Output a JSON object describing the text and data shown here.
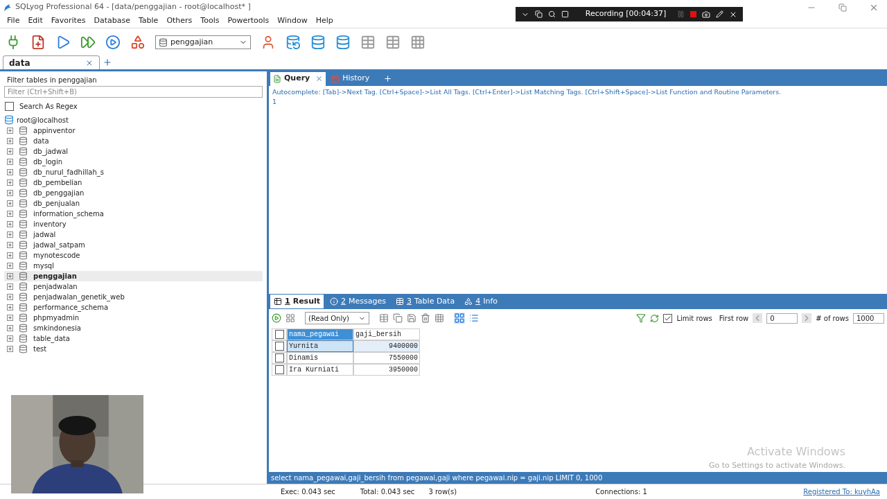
{
  "window": {
    "title": "SQLyog Professional 64 - [data/penggajian - root@localhost* ]"
  },
  "recording": {
    "label": "Recording [00:04:37]"
  },
  "menu": [
    "File",
    "Edit",
    "Favorites",
    "Database",
    "Table",
    "Others",
    "Tools",
    "Powertools",
    "Window",
    "Help"
  ],
  "toolbar": {
    "database": "penggajian"
  },
  "connection_tabs": [
    {
      "label": "data",
      "selected": true
    }
  ],
  "sidebar": {
    "filter_label": "Filter tables in penggajian",
    "filter_placeholder": "Filter (Ctrl+Shift+B)",
    "regex": {
      "label": "Search As Regex",
      "checked": false
    },
    "root": "root@localhost",
    "databases": [
      {
        "name": "appinventor",
        "selected": false
      },
      {
        "name": "data",
        "selected": false
      },
      {
        "name": "db_jadwal",
        "selected": false
      },
      {
        "name": "db_login",
        "selected": false
      },
      {
        "name": "db_nurul_fadhillah_s",
        "selected": false
      },
      {
        "name": "db_pembelian",
        "selected": false
      },
      {
        "name": "db_penggajian",
        "selected": false
      },
      {
        "name": "db_penjualan",
        "selected": false
      },
      {
        "name": "information_schema",
        "selected": false
      },
      {
        "name": "inventory",
        "selected": false
      },
      {
        "name": "jadwal",
        "selected": false
      },
      {
        "name": "jadwal_satpam",
        "selected": false
      },
      {
        "name": "mynotescode",
        "selected": false
      },
      {
        "name": "mysql",
        "selected": false
      },
      {
        "name": "penggajian",
        "selected": true
      },
      {
        "name": "penjadwalan",
        "selected": false
      },
      {
        "name": "penjadwalan_genetik_web",
        "selected": false
      },
      {
        "name": "performance_schema",
        "selected": false
      },
      {
        "name": "phpmyadmin",
        "selected": false
      },
      {
        "name": "smkindonesia",
        "selected": false
      },
      {
        "name": "table_data",
        "selected": false
      },
      {
        "name": "test",
        "selected": false
      }
    ]
  },
  "query_tabs": [
    {
      "label": "Query",
      "selected": true,
      "kind": "query"
    },
    {
      "label": "History",
      "selected": false,
      "kind": "history"
    }
  ],
  "editor": {
    "hint": "Autocomplete: [Tab]->Next Tag. [Ctrl+Space]->List All Tags. [Ctrl+Enter]->List Matching Tags. [Ctrl+Shift+Space]->List Function and Routine Parameters.",
    "line_number": "1"
  },
  "result_tabs": [
    {
      "number": "1",
      "label": "Result",
      "selected": true,
      "kind": "result"
    },
    {
      "number": "2",
      "label": "Messages",
      "selected": false,
      "kind": "messages"
    },
    {
      "number": "3",
      "label": "Table Data",
      "selected": false,
      "kind": "table"
    },
    {
      "number": "4",
      "label": "Info",
      "selected": false,
      "kind": "info"
    }
  ],
  "result_toolbar": {
    "mode": "(Read Only)",
    "limit_rows": {
      "label": "Limit rows",
      "checked": true
    },
    "first_row_label": "First row",
    "first_row": "0",
    "rows_label": "# of rows",
    "rows": "1000"
  },
  "table": {
    "select_all": false,
    "columns": [
      {
        "label": "nama_pegawai",
        "selected": true
      },
      {
        "label": "gaji_bersih",
        "selected": false
      }
    ],
    "rows": [
      {
        "cells": [
          "Yurnita",
          "9400000"
        ],
        "checked": false,
        "selected": true
      },
      {
        "cells": [
          "Dinamis",
          "7550000"
        ],
        "checked": false,
        "selected": false
      },
      {
        "cells": [
          "Ira Kurniati",
          "3950000"
        ],
        "checked": false,
        "selected": false
      }
    ]
  },
  "watermark": {
    "title": "Activate Windows",
    "subtitle": "Go to Settings to activate Windows."
  },
  "sql_line": "select nama_pegawai,gaji_bersih from pegawai,gaji where pegawai.nip = gaji.nip LIMIT 0, 1000",
  "status": {
    "exec": "Exec: 0.043 sec",
    "total": "Total: 0.043 sec",
    "rows": "3 row(s)",
    "connections": "Connections: 1",
    "registered": "Registered To: kuyhAa"
  }
}
